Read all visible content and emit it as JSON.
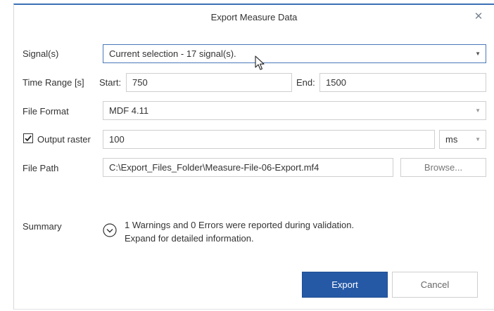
{
  "dialog": {
    "title": "Export Measure Data",
    "close_glyph": "✕"
  },
  "signals": {
    "label": "Signal(s)",
    "value": "Current selection - 17 signal(s)."
  },
  "time_range": {
    "label": "Time Range [s]",
    "start_label": "Start:",
    "start_value": "750",
    "end_label": "End:",
    "end_value": "1500"
  },
  "file_format": {
    "label": "File Format",
    "value": "MDF 4.11"
  },
  "output_raster": {
    "label": "Output raster",
    "checked": true,
    "value": "100",
    "unit": "ms"
  },
  "file_path": {
    "label": "File Path",
    "value": "C:\\Export_Files_Folder\\Measure-File-06-Export.mf4",
    "browse_label": "Browse..."
  },
  "summary": {
    "label": "Summary",
    "line1": "1 Warnings and 0 Errors were reported during validation.",
    "line2": "Expand for detailed information."
  },
  "buttons": {
    "export_label": "Export",
    "cancel_label": "Cancel"
  },
  "icons": {
    "close": "close-icon",
    "dropdown": "chevron-down-icon",
    "expand": "expand-circle-icon",
    "checkmark": "checkmark-icon",
    "cursor": "mouse-pointer-icon"
  },
  "colors": {
    "accent": "#2559a6",
    "title_border": "#3b6fb6",
    "active_border": "#4a78b8"
  }
}
